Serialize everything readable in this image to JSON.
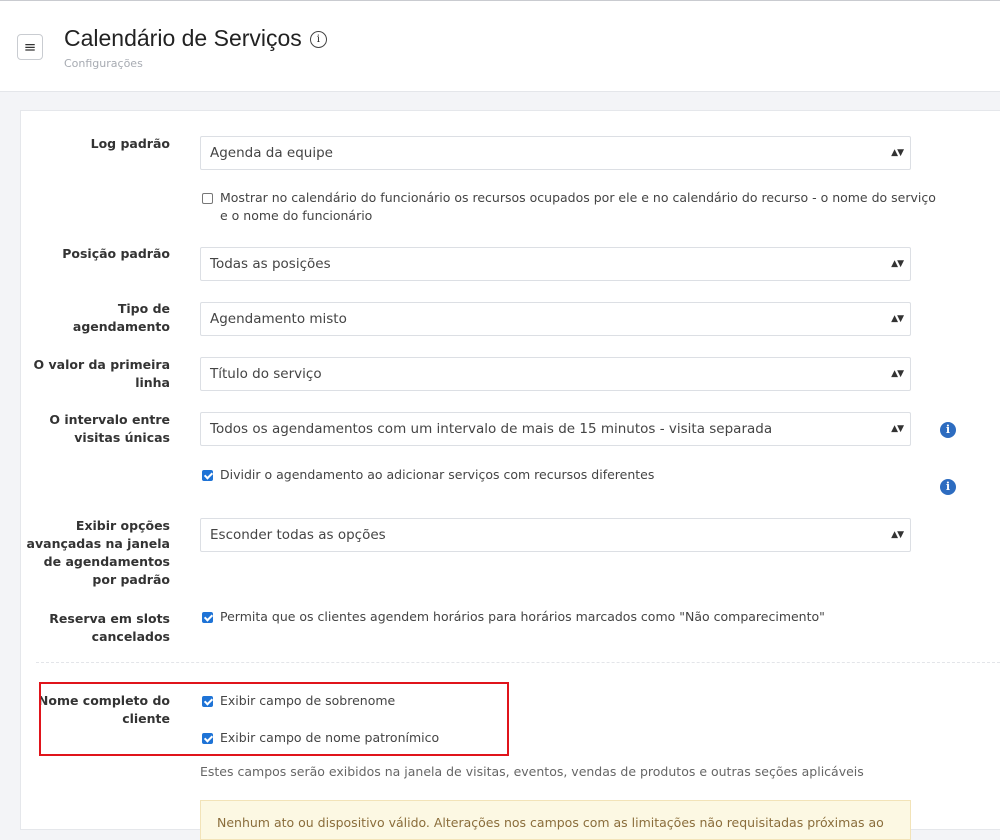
{
  "header": {
    "menu_icon": "≡",
    "title": "Calendário de Serviços",
    "info_glyph": "i",
    "subtitle": "Configurações"
  },
  "form": {
    "log_padrao": {
      "label": "Log padrão",
      "value": "Agenda da equipe"
    },
    "mostrar_calendario": {
      "checked": false,
      "text_line1": "Mostrar no calendário do funcionário os recursos ocupados por ele e no calendário do recurso - o nome do serviço",
      "text_line2": "e o nome do funcionário"
    },
    "posicao_padrao": {
      "label": "Posição padrão",
      "value": "Todas as posições"
    },
    "tipo_agendamento": {
      "label_line1": "Tipo de",
      "label_line2": "agendamento",
      "value": "Agendamento misto"
    },
    "primeira_linha": {
      "label_line1": "O valor da primeira",
      "label_line2": "linha",
      "value": "Título do serviço"
    },
    "intervalo": {
      "label_line1": "O intervalo entre",
      "label_line2": "visitas únicas",
      "value": "Todos os agendamentos com um intervalo de mais de 15 minutos - visita separada"
    },
    "dividir": {
      "checked": true,
      "text": "Dividir o agendamento ao adicionar serviços com recursos diferentes"
    },
    "opcoes_avancadas": {
      "label_line1": "Exibir opções",
      "label_line2": "avançadas na janela",
      "label_line3": "de agendamentos",
      "label_line4": "por padrão",
      "value": "Esconder todas as opções"
    },
    "slots_cancelados": {
      "label_line1": "Reserva em slots",
      "label_line2": "cancelados",
      "checked": true,
      "text": "Permita que os clientes agendem horários para horários marcados como \"Não comparecimento\""
    },
    "nome_completo": {
      "label_line1": "Nome completo do",
      "label_line2": "cliente",
      "sobrenome": {
        "checked": true,
        "text": "Exibir campo de sobrenome"
      },
      "patronimico": {
        "checked": true,
        "text": "Exibir campo de nome patronímico"
      },
      "help": "Estes campos serão exibidos na janela de visitas, eventos, vendas de produtos e outras seções aplicáveis"
    },
    "alert_partial": "Nenhum ato ou dispositivo válido. Alterações nos campos com as limitações não requisitadas próximas ao",
    "select_arrow": "▲▼",
    "info_glyph": "i"
  },
  "colors": {
    "accent": "#1e73d6",
    "info": "#2d6cc0",
    "highlight": "#e0141b",
    "alert_bg": "#fcf8e3"
  }
}
